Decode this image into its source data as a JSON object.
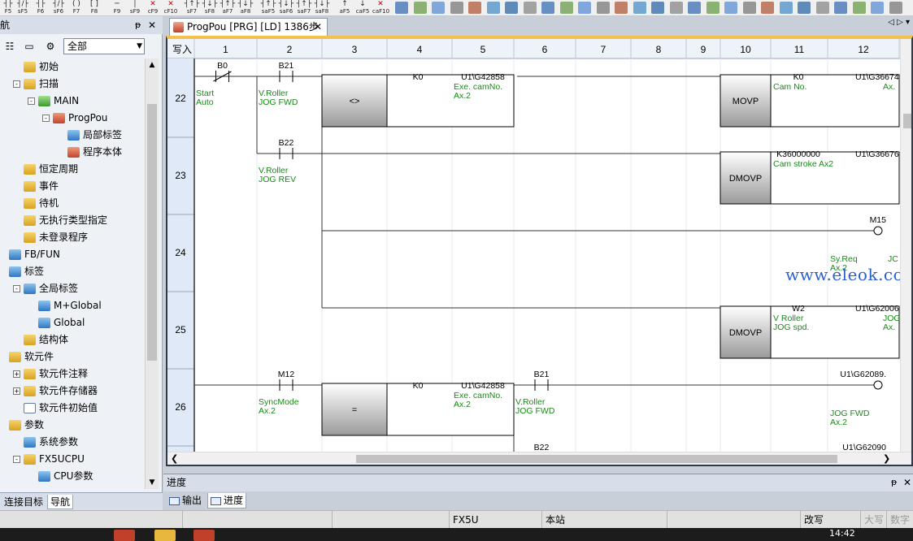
{
  "toolbar": {
    "keys": [
      {
        "label": "F5",
        "sym": "┤├"
      },
      {
        "label": "sF5",
        "sym": "┤/├"
      },
      {
        "label": "F6",
        "sym": "┤├"
      },
      {
        "label": "sF6",
        "sym": "┤/├"
      },
      {
        "label": "F7",
        "sym": "( )"
      },
      {
        "label": "F8",
        "sym": "[ ]"
      },
      {
        "label": "F9",
        "sym": "─"
      },
      {
        "label": "sF9",
        "sym": "│"
      },
      {
        "label": "cF9",
        "sym": "✕",
        "red": true
      },
      {
        "label": "cF10",
        "sym": "✕",
        "red": true
      },
      {
        "label": "sF7",
        "sym": "┤↑├"
      },
      {
        "label": "sF8",
        "sym": "┤↓├"
      },
      {
        "label": "aF7",
        "sym": "┤↑├"
      },
      {
        "label": "aF8",
        "sym": "┤↓├"
      },
      {
        "label": "saF5",
        "sym": "┤↑├"
      },
      {
        "label": "saF6",
        "sym": "┤↓├"
      },
      {
        "label": "saF7",
        "sym": "┤↑├"
      },
      {
        "label": "saF8",
        "sym": "┤↓├"
      },
      {
        "label": "aF5",
        "sym": "↑"
      },
      {
        "label": "caF5",
        "sym": "↓"
      },
      {
        "label": "caF10",
        "sym": "✕",
        "red": true
      }
    ],
    "icon_count": 28
  },
  "nav": {
    "title": "航",
    "filter_value": "全部",
    "tree": [
      {
        "label": "初始",
        "indent": 1,
        "icon": "ic-yellow"
      },
      {
        "label": "扫描",
        "indent": 1,
        "icon": "ic-yellow",
        "exp": "-"
      },
      {
        "label": "MAIN",
        "indent": 2,
        "icon": "ic-green",
        "exp": "-"
      },
      {
        "label": "ProgPou",
        "indent": 3,
        "icon": "ic-red",
        "exp": "-"
      },
      {
        "label": "局部标签",
        "indent": 4,
        "icon": "ic-blue"
      },
      {
        "label": "程序本体",
        "indent": 4,
        "icon": "ic-red"
      },
      {
        "label": "恒定周期",
        "indent": 1,
        "icon": "ic-yellow"
      },
      {
        "label": "事件",
        "indent": 1,
        "icon": "ic-yellow"
      },
      {
        "label": "待机",
        "indent": 1,
        "icon": "ic-yellow"
      },
      {
        "label": "无执行类型指定",
        "indent": 1,
        "icon": "ic-yellow"
      },
      {
        "label": "未登录程序",
        "indent": 1,
        "icon": "ic-yellow"
      },
      {
        "label": "FB/FUN",
        "indent": 0,
        "icon": "ic-blue"
      },
      {
        "label": "标签",
        "indent": 0,
        "icon": "ic-blue"
      },
      {
        "label": "全局标签",
        "indent": 1,
        "icon": "ic-blue",
        "exp": "-"
      },
      {
        "label": "M+Global",
        "indent": 2,
        "icon": "ic-blue"
      },
      {
        "label": "Global",
        "indent": 2,
        "icon": "ic-blue"
      },
      {
        "label": "结构体",
        "indent": 1,
        "icon": "ic-yellow"
      },
      {
        "label": "软元件",
        "indent": 0,
        "icon": "ic-yellow"
      },
      {
        "label": "软元件注释",
        "indent": 1,
        "icon": "ic-yellow",
        "exp": "+"
      },
      {
        "label": "软元件存储器",
        "indent": 1,
        "icon": "ic-yellow",
        "exp": "+"
      },
      {
        "label": "软元件初始值",
        "indent": 1,
        "icon": "ic-doc"
      },
      {
        "label": "参数",
        "indent": 0,
        "icon": "ic-yellow"
      },
      {
        "label": "系统参数",
        "indent": 1,
        "icon": "ic-blue"
      },
      {
        "label": "FX5UCPU",
        "indent": 1,
        "icon": "ic-yellow",
        "exp": "-"
      },
      {
        "label": "CPU参数",
        "indent": 2,
        "icon": "ic-blue"
      }
    ],
    "tabs": [
      {
        "label": "连接目标",
        "active": false
      },
      {
        "label": "导航",
        "active": true
      }
    ]
  },
  "editor": {
    "tab_title": "ProgPou [PRG] [LD] 1386步",
    "tab_nav": "◁ ▷ ▾",
    "corner_label": "写入",
    "column_numbers": [
      "1",
      "2",
      "3",
      "4",
      "5",
      "6",
      "7",
      "8",
      "9",
      "10",
      "11",
      "12"
    ],
    "steps": [
      "22",
      "23",
      "24",
      "25",
      "26"
    ],
    "watermark": "www.eleok.com"
  },
  "ladder": {
    "contacts": [
      {
        "row": 0,
        "col": 0,
        "name": "B0",
        "type": "nc",
        "comment": [
          "Start",
          "Auto"
        ]
      },
      {
        "row": 0,
        "col": 1,
        "name": "B21",
        "type": "no",
        "comment": [
          "V.Roller",
          "JOG FWD"
        ]
      },
      {
        "row": 1,
        "col": 1,
        "name": "B22",
        "type": "no",
        "comment": [
          "V.Roller",
          "JOG REV"
        ]
      },
      {
        "row": 4,
        "col": 1,
        "name": "M12",
        "type": "no",
        "comment": [
          "SyncMode",
          "Ax.2"
        ]
      },
      {
        "row": 4,
        "col": 5,
        "name": "B21",
        "type": "no",
        "comment": [
          "V.Roller",
          "JOG FWD"
        ]
      },
      {
        "row": 4.94,
        "col": 5,
        "name": "B22",
        "type": "no",
        "comment": []
      }
    ],
    "compare_blocks": [
      {
        "row": 0,
        "op": "<>",
        "s1": "K0",
        "s2": "U1\\G42858",
        "s2_comment": [
          "Exe. camNo.",
          "Ax.2"
        ]
      },
      {
        "row": 4,
        "op": "=",
        "s1": "K0",
        "s2": "U1\\G42858",
        "s2_comment": [
          "Exe. camNo.",
          "Ax.2"
        ]
      }
    ],
    "instructions": [
      {
        "row": 0,
        "name": "MOVP",
        "s": "K0",
        "s_comment": [
          "Cam No.",
          ""
        ],
        "d": "U1\\G36674",
        "d_comment": [
          "Ax.",
          ""
        ]
      },
      {
        "row": 1,
        "name": "DMOVP",
        "s": "K36000000",
        "s_comment": [
          "Cam stroke Ax2"
        ],
        "d": "U1\\G36676",
        "d_comment": []
      },
      {
        "row": 3,
        "name": "DMOVP",
        "s": "W2",
        "s_comment": [
          "V Roller",
          "JOG spd."
        ],
        "d": "U1\\G62006",
        "d_comment": [
          "JOG spd.",
          "Ax."
        ]
      }
    ],
    "coils": [
      {
        "row": 2,
        "name": "M15",
        "comment": [
          "Sy.Req",
          "Ax.2",
          "JC"
        ]
      },
      {
        "row": 4,
        "name": "U1\\G62089.",
        "comment": [
          "JOG FWD",
          "Ax.2"
        ]
      },
      {
        "row": 4.94,
        "name": "U1\\G62090",
        "comment": []
      }
    ]
  },
  "progress_pane": {
    "title": "进度",
    "tabs": [
      {
        "label": "输出",
        "active": false
      },
      {
        "label": "进度",
        "active": true
      }
    ]
  },
  "statusbar": {
    "cells": [
      {
        "text": "",
        "gray": false
      },
      {
        "text": "",
        "gray": false
      },
      {
        "text": "FX5U",
        "gray": false
      },
      {
        "text": "本站",
        "gray": false
      },
      {
        "text": "",
        "gray": false
      },
      {
        "text": "改写",
        "gray": false
      },
      {
        "text": "大写",
        "gray": true
      },
      {
        "text": "数字",
        "gray": true
      }
    ]
  },
  "taskbar": {
    "clock": "14:42"
  },
  "colors": {
    "comment_green": "#1a8a1a",
    "step_bg": "#dfe9f7",
    "rung_line": "#333333",
    "accent_orange": "#f2c14e"
  }
}
